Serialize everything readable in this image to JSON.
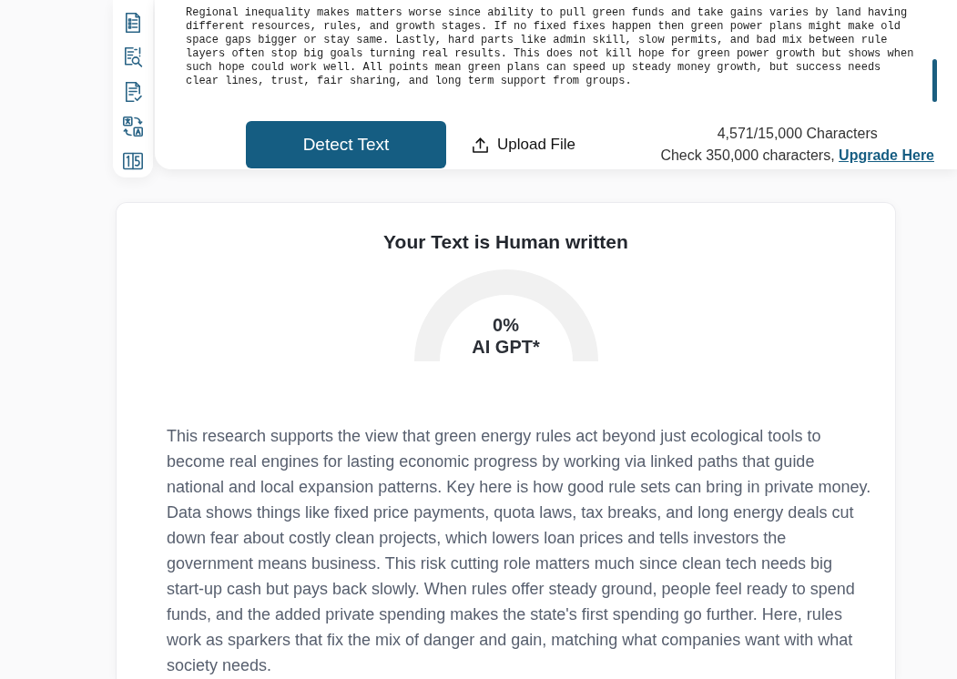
{
  "editor": {
    "text": "Regional inequality makes matters worse since ability to pull green funds and take gains varies by land having different resources, rules, and growth stages. If no fixed fixes happen then green power plans might make old space gaps bigger or stay same. Lastly, hard parts like admin skill, slow permits, and bad mix between rule layers often stop big goals turning real results. This does not kill hope for green power growth but shows when such hope could work well. All points mean green plans can speed up steady money growth, but success needs clear lines, trust, fair sharing, and long term support from groups."
  },
  "actions": {
    "detect_button": "Detect Text",
    "upload_button": "Upload File"
  },
  "usage": {
    "count": "4,571/15,000 Characters",
    "note": "Check 350,000 characters,",
    "link": "Upgrade Here"
  },
  "result": {
    "title": "Your Text is Human written",
    "gauge": {
      "percent": "0%",
      "label": "AI GPT*"
    },
    "summary": "This research supports the view that green energy rules act beyond just ecological tools to become real engines for lasting economic progress by working via linked paths that guide national and local expansion patterns. Key here is how good rule sets can bring in private money. Data shows things like fixed price payments, quota laws, tax breaks, and long energy deals cut down fear about costly clean projects, which lowers loan prices and tells investors the government means business. This risk cutting role matters much since clean tech needs big start-up cash but pays back slowly. When rules offer steady ground, people feel ready to spend funds, and the added private spending makes the state's first spending go further. Here, rules work as sparkers that fix the mix of danger and gain, matching what companies want with what society needs."
  }
}
